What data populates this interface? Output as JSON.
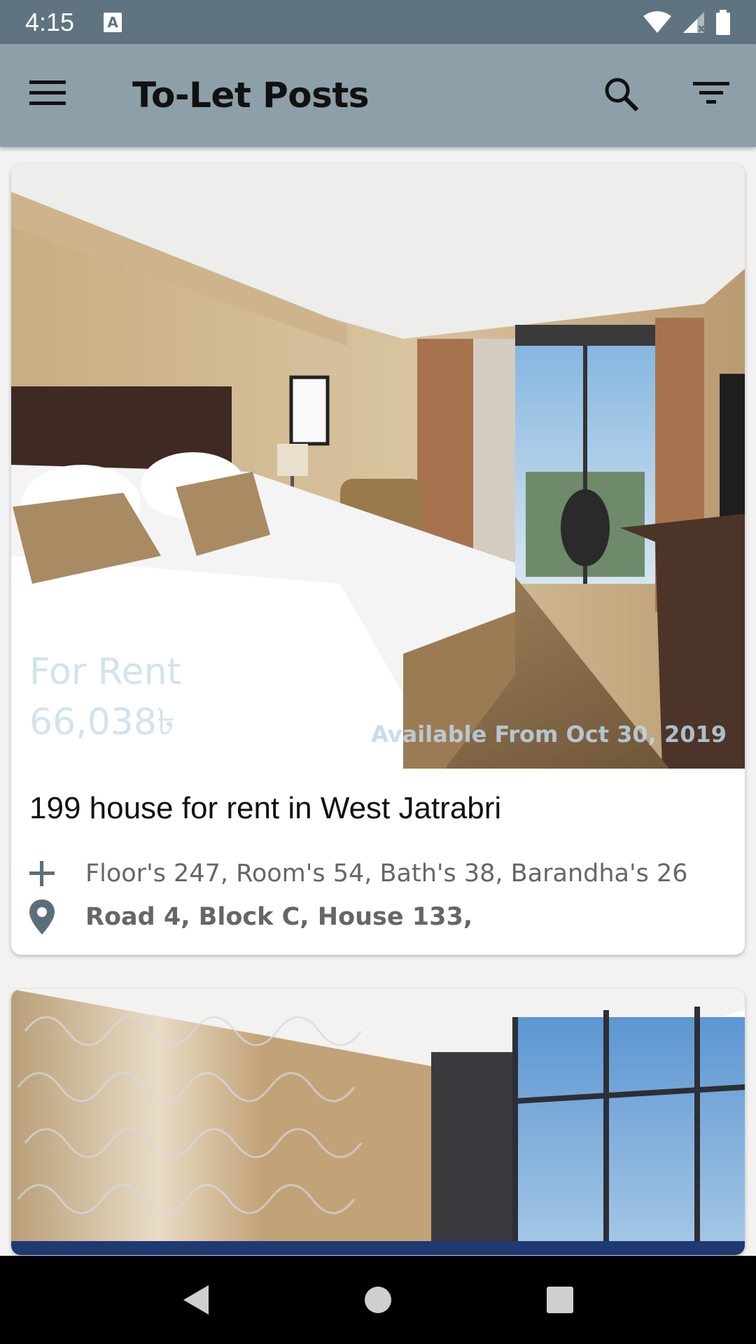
{
  "status_bar": {
    "time": "4:15",
    "notification_icon": "a-icon"
  },
  "app_bar": {
    "title": "To-Let Posts",
    "menu_icon": "hamburger-menu-icon",
    "search_icon": "search-icon",
    "filter_icon": "filter-icon"
  },
  "posts": [
    {
      "rent_type": "For Rent",
      "price": "66,038৳",
      "available_from": "Available From Oct 30, 2019",
      "title": "199 house for rent in West Jatrabri",
      "features": "Floor's 247, Room's 54, Bath's 38, Barandha's 26",
      "address": "Road 4, Block C, House 133,"
    }
  ],
  "colors": {
    "status_bar": "#5f7480",
    "app_bar": "#8d9fa8",
    "icon_gray": "#5b6f7a"
  }
}
